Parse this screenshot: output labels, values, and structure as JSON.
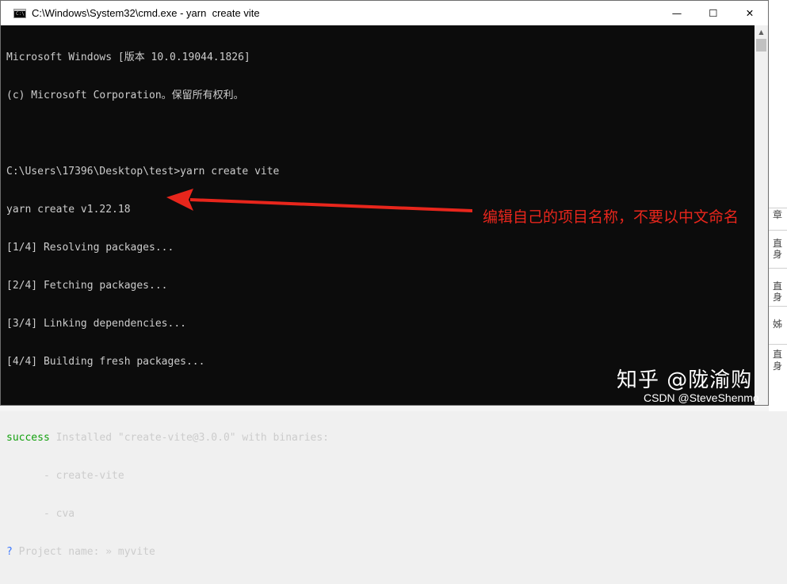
{
  "window": {
    "title": "C:\\Windows\\System32\\cmd.exe - yarn  create vite",
    "icon_label": "C:\\",
    "controls": {
      "minimize": "—",
      "maximize": "☐",
      "close": "✕"
    }
  },
  "terminal": {
    "lines": [
      "Microsoft Windows [版本 10.0.19044.1826]",
      "(c) Microsoft Corporation。保留所有权利。",
      "",
      "C:\\Users\\17396\\Desktop\\test>yarn create vite",
      "yarn create v1.22.18",
      "[1/4] Resolving packages...",
      "[2/4] Fetching packages...",
      "[3/4] Linking dependencies...",
      "[4/4] Building fresh packages...",
      ""
    ],
    "success_word": "success",
    "success_rest": " Installed \"create-vite@3.0.0\" with binaries:",
    "binaries": [
      "      - create-vite",
      "      - cva"
    ],
    "prompt_mark": "?",
    "prompt_label": " Project name: » ",
    "prompt_value": "myvite"
  },
  "annotation": {
    "text": "编辑自己的项目名称，不要以中文命名",
    "color": "#e8261c"
  },
  "watermarks": {
    "zhihu": "知乎 @陇渝购",
    "csdn": "CSDN @SteveShenmo"
  },
  "side_chars": [
    "章",
    "直",
    "身",
    "直",
    "身",
    "姊",
    "直",
    "身"
  ],
  "colors": {
    "terminal_bg": "#0c0c0c",
    "terminal_fg": "#cccccc",
    "success": "#13a10e",
    "prompt": "#3b78ff"
  }
}
